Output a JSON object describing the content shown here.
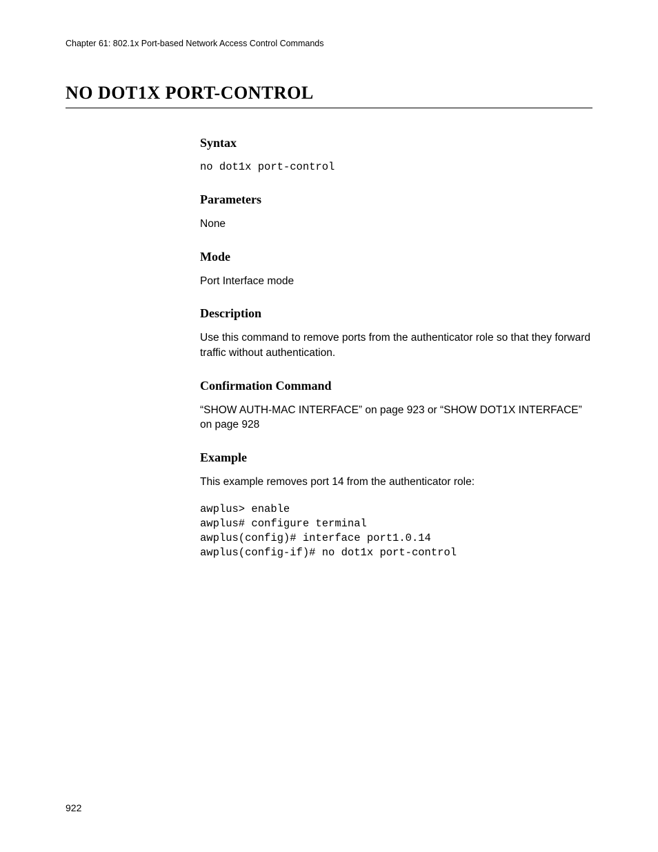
{
  "header": {
    "chapter_line": "Chapter 61: 802.1x Port-based Network Access Control Commands"
  },
  "title": "NO DOT1X PORT-CONTROL",
  "sections": {
    "syntax": {
      "heading": "Syntax",
      "body": "no dot1x port-control"
    },
    "parameters": {
      "heading": "Parameters",
      "body": "None"
    },
    "mode": {
      "heading": "Mode",
      "body": "Port Interface mode"
    },
    "description": {
      "heading": "Description",
      "body": "Use this command to remove ports from the authenticator role so that they forward traffic without authentication."
    },
    "confirmation": {
      "heading": "Confirmation Command",
      "body": "“SHOW AUTH-MAC INTERFACE” on page 923 or “SHOW DOT1X INTERFACE” on page 928"
    },
    "example": {
      "heading": "Example",
      "intro": "This example removes port 14 from the authenticator role:",
      "code": "awplus> enable\nawplus# configure terminal\nawplus(config)# interface port1.0.14\nawplus(config-if)# no dot1x port-control"
    }
  },
  "page_number": "922"
}
